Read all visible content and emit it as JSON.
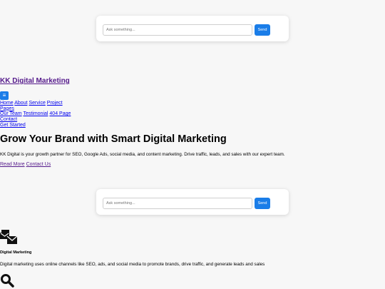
{
  "chat_top": {
    "placeholder": "Ask something...",
    "send_label": "Send"
  },
  "brand": {
    "title": "KK Digital Marketing",
    "toggler_icon": "menu-icon"
  },
  "nav": {
    "home": "Home",
    "about": "About",
    "service": "Service",
    "project": "Project",
    "pages": "Pages",
    "our_team": "Our Team",
    "testimonial": "Testimonial",
    "page404": "404 Page",
    "contact": "Contact",
    "get_started": "Get Started"
  },
  "hero": {
    "title": "Grow Your Brand with Smart Digital Marketing",
    "text": "KK Digital is your growth partner for SEO, Google Ads, social media, and content marketing. Drive traffic, leads, and sales with our expert team.",
    "read_more": "Read More",
    "contact_us": "Contact Us"
  },
  "chat_mid": {
    "placeholder": "Ask something...",
    "send_label": "Send"
  },
  "service": {
    "icon": "mail-bulk-icon",
    "title": "Digital Marketing",
    "text": "Digital marketing uses online channels like SEO, ads, and social media to promote brands, drive traffic, and generate leads and sales",
    "next_icon": "search-icon"
  },
  "colors": {
    "accent": "#1a7de8",
    "link": "#551a8b",
    "background": "#f7f7f7"
  }
}
